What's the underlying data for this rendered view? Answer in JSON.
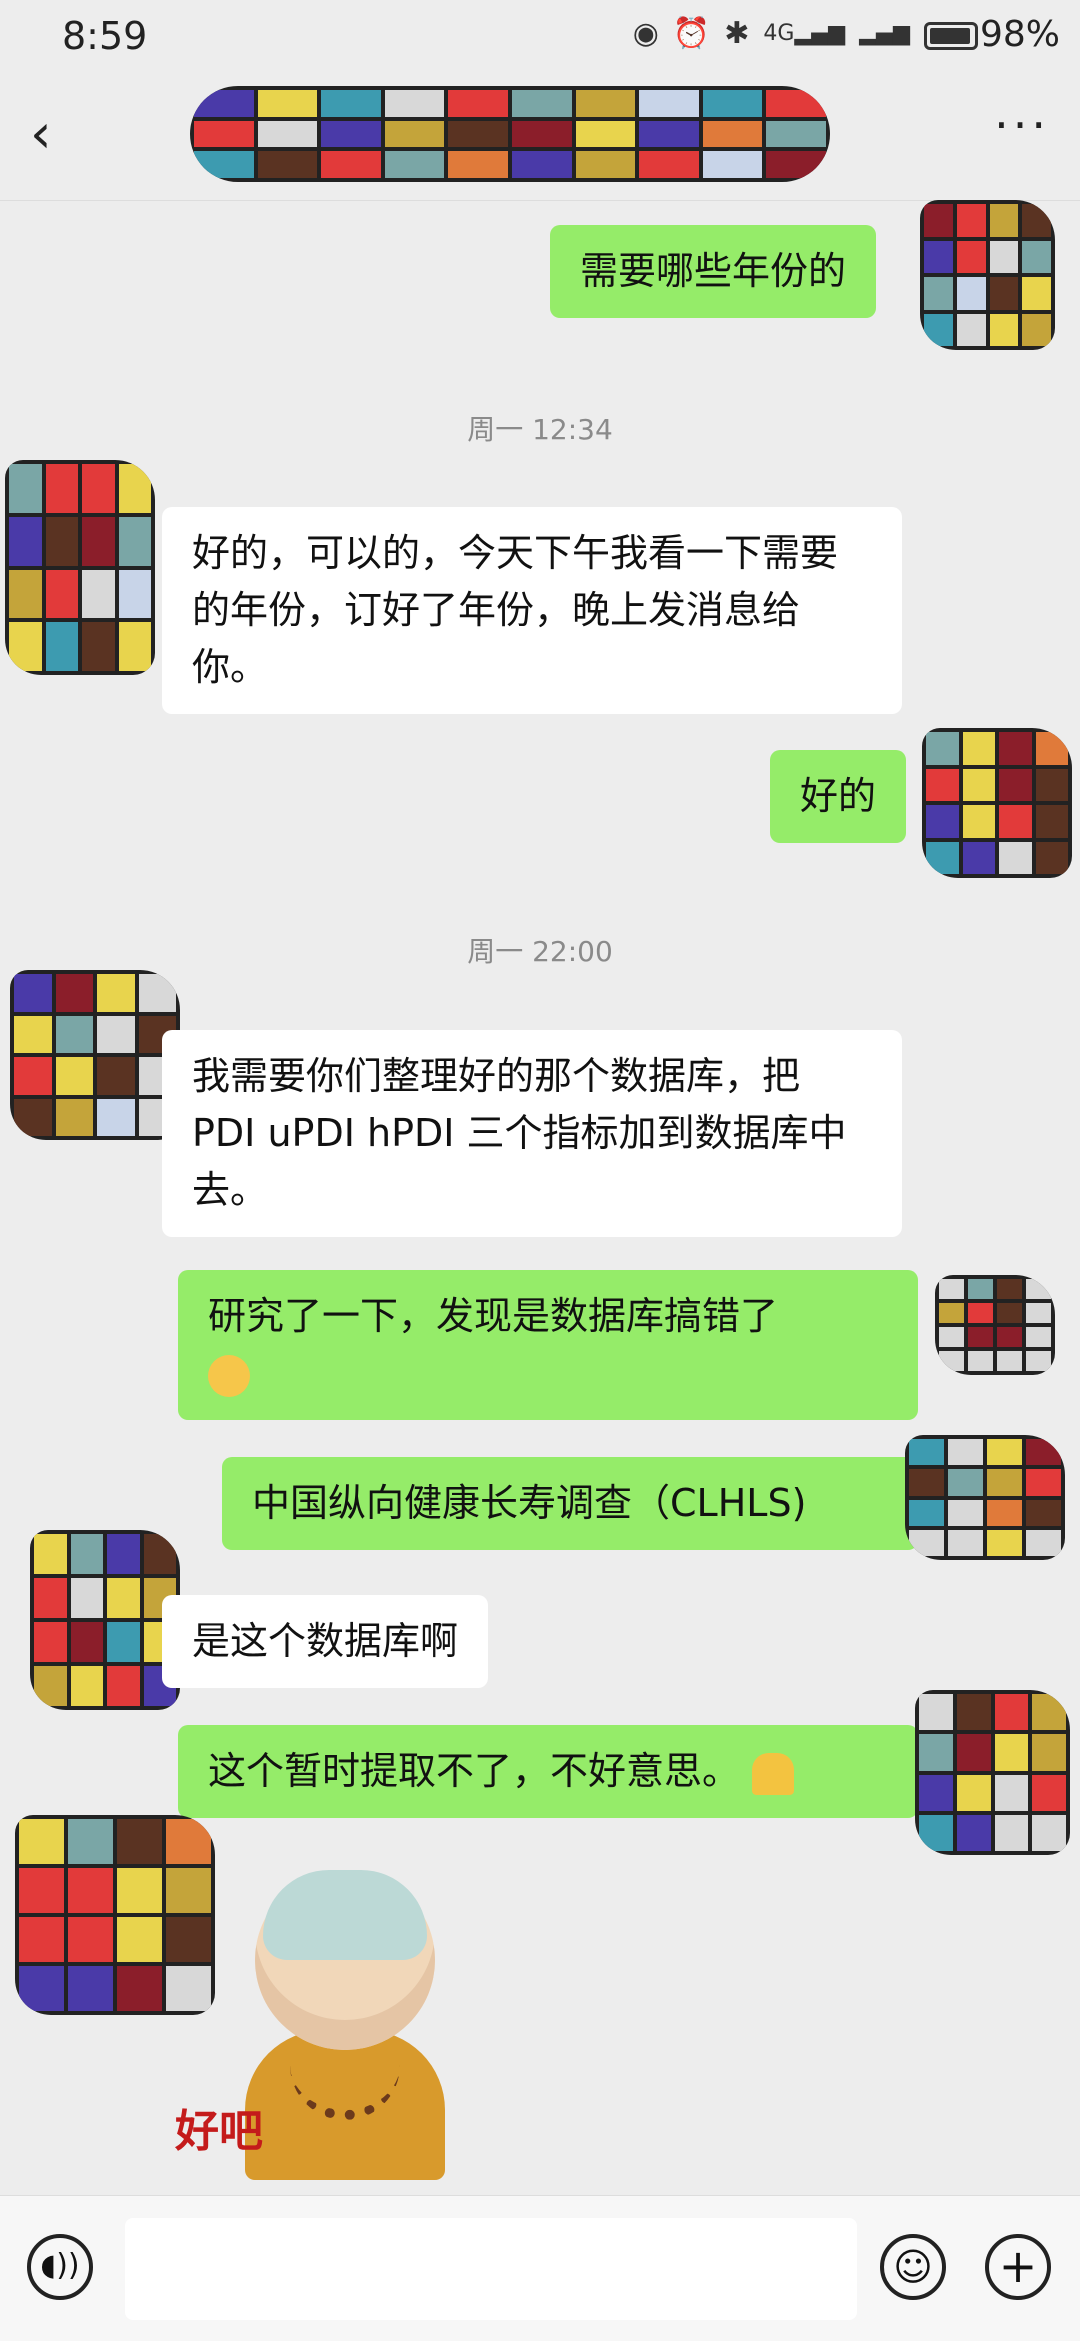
{
  "status_bar": {
    "time": "8:59",
    "network": "4G",
    "battery": "98%"
  },
  "header": {
    "title": "",
    "back_icon": "chevron-left-icon",
    "more_icon": "more-dots-icon"
  },
  "timestamps": [
    "周一 12:34",
    "周一 22:00"
  ],
  "messages": [
    {
      "side": "sent",
      "text": "需要哪些年份的"
    },
    {
      "side": "recv",
      "text": "好的，可以的，今天下午我看一下需要的年份，订好了年份，晚上发消息给你。"
    },
    {
      "side": "sent",
      "text": "好的"
    },
    {
      "side": "recv",
      "text": " 我需要你们整理好的那个数据库，把 PDI uPDI hPDI 三个指标加到数据库中去。"
    },
    {
      "side": "sent",
      "text": "研究了一下，发现是数据库搞错了",
      "emoji": "laugh-cry-emoji"
    },
    {
      "side": "sent",
      "text": "中国纵向健康长寿调查（CLHLS)"
    },
    {
      "side": "recv",
      "text": "是这个数据库啊"
    },
    {
      "side": "sent",
      "text": "这个暂时提取不了，不好意思。",
      "emoji": "folded-hands-emoji"
    }
  ],
  "sticker": {
    "text": "好吧",
    "name": "little-monk-sticker"
  },
  "bottom_bar": {
    "input_value": "",
    "icons": [
      "voice-icon",
      "emoji-icon",
      "plus-icon"
    ]
  },
  "colors": {
    "sent_bubble": "#95ec69",
    "recv_bubble": "#ffffff",
    "background": "#ededed"
  }
}
